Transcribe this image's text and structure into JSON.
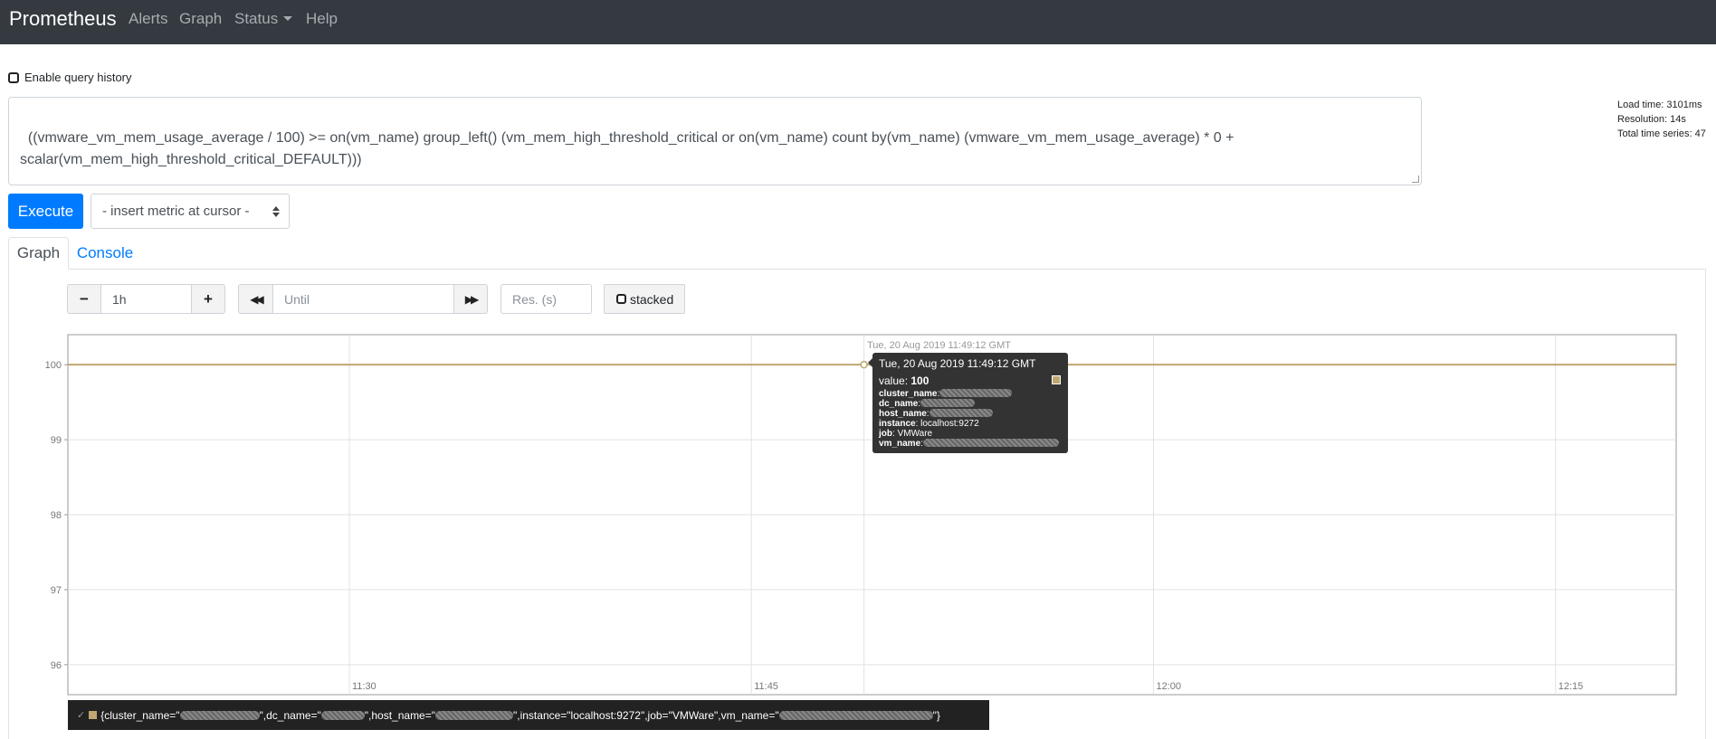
{
  "navbar": {
    "brand": "Prometheus",
    "items": [
      {
        "label": "Alerts"
      },
      {
        "label": "Graph"
      },
      {
        "label": "Status"
      },
      {
        "label": "Help"
      }
    ]
  },
  "query": {
    "history_label": "Enable query history",
    "expression": "((vmware_vm_mem_usage_average / 100) >= on(vm_name) group_left() (vm_mem_high_threshold_critical or on(vm_name) count by(vm_name) (vmware_vm_mem_usage_average) * 0 +\nscalar(vm_mem_high_threshold_critical_DEFAULT)))",
    "execute_label": "Execute",
    "metric_select": "- insert metric at cursor -"
  },
  "stats": {
    "load_time": "Load time: 3101ms",
    "resolution": "Resolution: 14s",
    "total_series": "Total time series: 47"
  },
  "tabs": [
    {
      "label": "Graph",
      "active": true
    },
    {
      "label": "Console",
      "active": false
    }
  ],
  "graph_controls": {
    "range_value": "1h",
    "until_placeholder": "Until",
    "resolution_placeholder": "Res. (s)",
    "stacked_label": "stacked"
  },
  "tooltip": {
    "hover_date": "Tue, 20 Aug 2019 11:49:12 GMT",
    "date": "Tue, 20 Aug 2019 11:49:12 GMT",
    "value_label": "value:",
    "value": "100",
    "labels": [
      {
        "key": "cluster_name",
        "value": ""
      },
      {
        "key": "dc_name",
        "value": ""
      },
      {
        "key": "host_name",
        "value": ""
      },
      {
        "key": "instance",
        "value": "localhost:9272"
      },
      {
        "key": "job",
        "value": "VMWare"
      },
      {
        "key": "vm_name",
        "value": ""
      }
    ]
  },
  "legend": {
    "p1": "{cluster_name=\"",
    "p2": "\",dc_name=\"",
    "p3": "\",host_name=\"",
    "p4": "\",instance=\"localhost:9272\",job=\"VMWare\",vm_name=\"",
    "p5": "\"}"
  },
  "colors": {
    "navbar": "#343a40",
    "primary": "#007bff",
    "series": "#c0a672"
  },
  "chart_data": {
    "type": "line",
    "xlabel": "",
    "ylabel": "",
    "x_ticks": [
      "11:30",
      "11:45",
      "12:00",
      "12:15"
    ],
    "y_ticks": [
      96,
      97,
      98,
      99,
      100
    ],
    "ylim": [
      95.6,
      100.4
    ],
    "xlim_minutes": [
      11.0,
      71.0
    ],
    "x_tick_minutes": [
      21.5,
      36.5,
      51.5,
      66.5
    ],
    "hover_minute": 40.7,
    "grid": true,
    "legend_position": "bottom",
    "series": [
      {
        "values": [
          100,
          100,
          100,
          100,
          100,
          100,
          100
        ],
        "x_minutes": [
          11,
          21,
          31,
          41,
          51,
          61,
          71
        ]
      }
    ]
  }
}
